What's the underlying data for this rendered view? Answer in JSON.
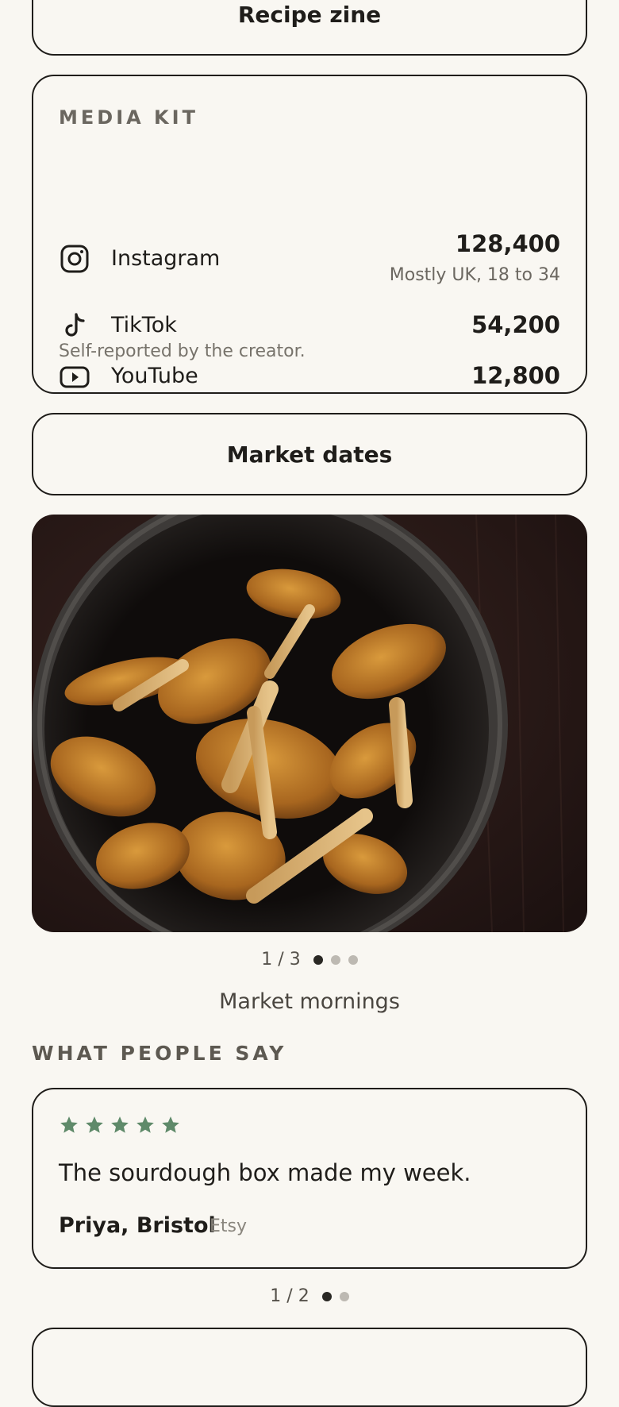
{
  "links": {
    "recipe_zine": "Recipe zine",
    "market_dates": "Market dates"
  },
  "media_kit": {
    "label": "MEDIA KIT",
    "platforms": [
      {
        "name": "Instagram",
        "icon": "instagram-icon",
        "count": "128,400",
        "note": "Mostly UK, 18 to 34"
      },
      {
        "name": "TikTok",
        "icon": "tiktok-icon",
        "count": "54,200"
      },
      {
        "name": "YouTube",
        "icon": "youtube-icon",
        "count": "12,800"
      }
    ],
    "footnote": "Self-reported by the creator."
  },
  "gallery": {
    "counter": "1 / 3",
    "total": 3,
    "active": 1,
    "caption": "Market mornings"
  },
  "testimonials": {
    "title": "WHAT PEOPLE SAY",
    "rating": 5,
    "star_color": "#5f8a6a",
    "quote": "The sourdough box made my week.",
    "author": "Priya, Bristol",
    "source": "Etsy",
    "counter": "1 / 2",
    "total": 2,
    "active": 1
  }
}
